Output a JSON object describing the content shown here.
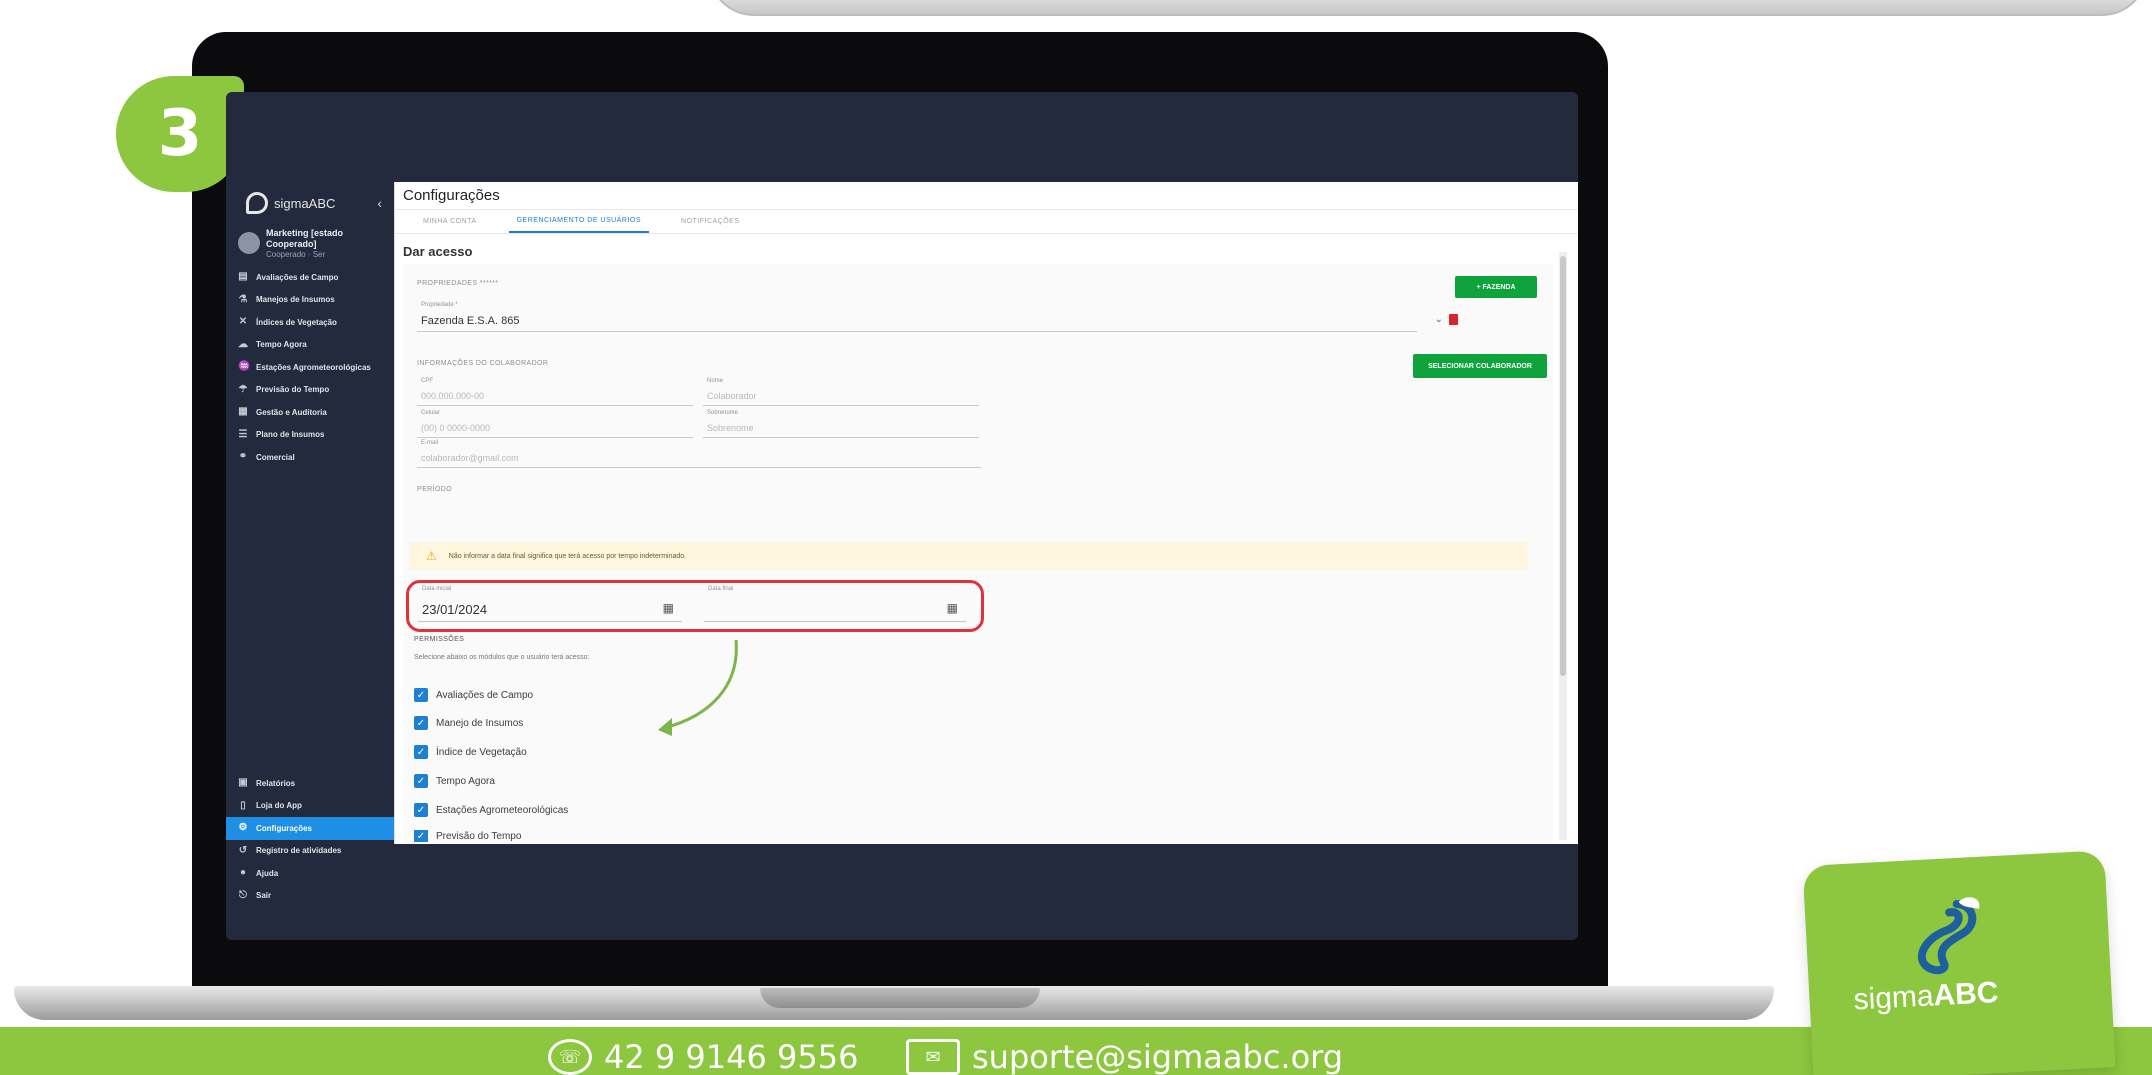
{
  "step": {
    "number": "3"
  },
  "app": {
    "logo_text": "sigmaABC",
    "user": {
      "name": "Marketing [estado Cooperado]",
      "role": "Cooperado · Ser"
    },
    "sidebar": {
      "items": [
        {
          "label": "Avaliações de Campo",
          "icon": "clipboard-icon"
        },
        {
          "label": "Manejos de Insumos",
          "icon": "flask-icon"
        },
        {
          "label": "Índices de Vegetação",
          "icon": "leaf-icon"
        },
        {
          "label": "Tempo Agora",
          "icon": "cloud-icon"
        },
        {
          "label": "Estações Agrometeorológicas",
          "icon": "station-icon"
        },
        {
          "label": "Previsão do Tempo",
          "icon": "weather-icon"
        },
        {
          "label": "Gestão e Auditoria",
          "icon": "chart-icon"
        },
        {
          "label": "Plano de Insumos",
          "icon": "list-icon"
        },
        {
          "label": "Comercial",
          "icon": "handshake-icon"
        }
      ],
      "bottom_items": [
        {
          "label": "Relatórios",
          "icon": "report-icon"
        },
        {
          "label": "Loja do App",
          "icon": "phone-icon"
        },
        {
          "label": "Configurações",
          "icon": "gear-icon",
          "active": true
        },
        {
          "label": "Registro de atividades",
          "icon": "history-icon"
        },
        {
          "label": "Ajuda",
          "icon": "help-icon"
        },
        {
          "label": "Sair",
          "icon": "logout-icon"
        }
      ]
    },
    "page_title": "Configurações",
    "tabs": [
      {
        "label": "MINHA CONTA",
        "active": false
      },
      {
        "label": "GERENCIAMENTO DE USUÁRIOS",
        "active": true
      },
      {
        "label": "NOTIFICAÇÕES",
        "active": false
      }
    ],
    "section_title": "Dar acesso",
    "propriedades": {
      "heading": "PROPRIEDADES ******",
      "field_label": "Propriedade *",
      "field_value": "Fazenda E.S.A. 865",
      "add_button": "+ FAZENDA"
    },
    "colaborador": {
      "heading": "INFORMAÇÕES DO COLABORADOR",
      "select_button": "SELECIONAR COLABORADOR",
      "fields": [
        {
          "label": "CPF",
          "value": "000.000.000-00"
        },
        {
          "label": "Nome",
          "value": "Colaborador"
        },
        {
          "label": "Celular",
          "value": "(00) 0 0000-0000"
        },
        {
          "label": "Sobrenome",
          "value": "Sobrenome"
        },
        {
          "label": "E-mail",
          "value": "colaborador@gmail.com"
        }
      ]
    },
    "periodo": {
      "heading": "PERÍODO",
      "warning": "Não informar a data final significa que terá acesso por tempo indeterminado.",
      "start_label": "Data inicial",
      "start_value": "23/01/2024",
      "end_label": "Data final",
      "end_value": ""
    },
    "permissoes": {
      "heading": "PERMISSÕES",
      "description": "Selecione abaixo os módulos que o usuário terá acesso:",
      "items": [
        "Avaliações de Campo",
        "Manejo de Insumos",
        "Índice de Vegetação",
        "Tempo Agora",
        "Estações Agrometeorológicas",
        "Previsão do Tempo"
      ]
    }
  },
  "footer": {
    "phone": "42 9 9146 9556",
    "email": "suporte@sigmaabc.org"
  },
  "brand": {
    "name_light": "sigma",
    "name_bold": "ABC"
  },
  "colors": {
    "accent_green": "#8dc63f",
    "button_green": "#0fa33c",
    "nav_active": "#1f8fe6",
    "highlight": "#e0323a"
  }
}
